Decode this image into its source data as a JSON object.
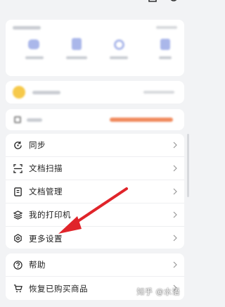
{
  "colors": {
    "background": "#f2f3f5",
    "card": "#ffffff",
    "accent_orange": "#f08a5d",
    "coin": "#f6c94a",
    "feature_blue": "#aab7ea",
    "annotation_arrow": "#e0242a"
  },
  "top_bar": {
    "icons": [
      "share-icon",
      "settings-icon"
    ]
  },
  "quick_features": {
    "items": [
      {
        "icon": "cloud-icon"
      },
      {
        "icon": "document-icon"
      },
      {
        "icon": "search-icon"
      },
      {
        "icon": "more-icon"
      }
    ]
  },
  "menu_group_1": [
    {
      "label": "同步",
      "icon": "sync-icon"
    },
    {
      "label": "文档扫描",
      "icon": "scan-icon"
    },
    {
      "label": "文档管理",
      "icon": "document-manage-icon"
    },
    {
      "label": "我的打印机",
      "icon": "printer-layers-icon"
    },
    {
      "label": "更多设置",
      "icon": "gear-icon"
    }
  ],
  "menu_group_2": [
    {
      "label": "帮助",
      "icon": "help-icon"
    },
    {
      "label": "恢复已购买商品",
      "icon": "cart-icon"
    }
  ],
  "watermark": "知乎 @水语"
}
